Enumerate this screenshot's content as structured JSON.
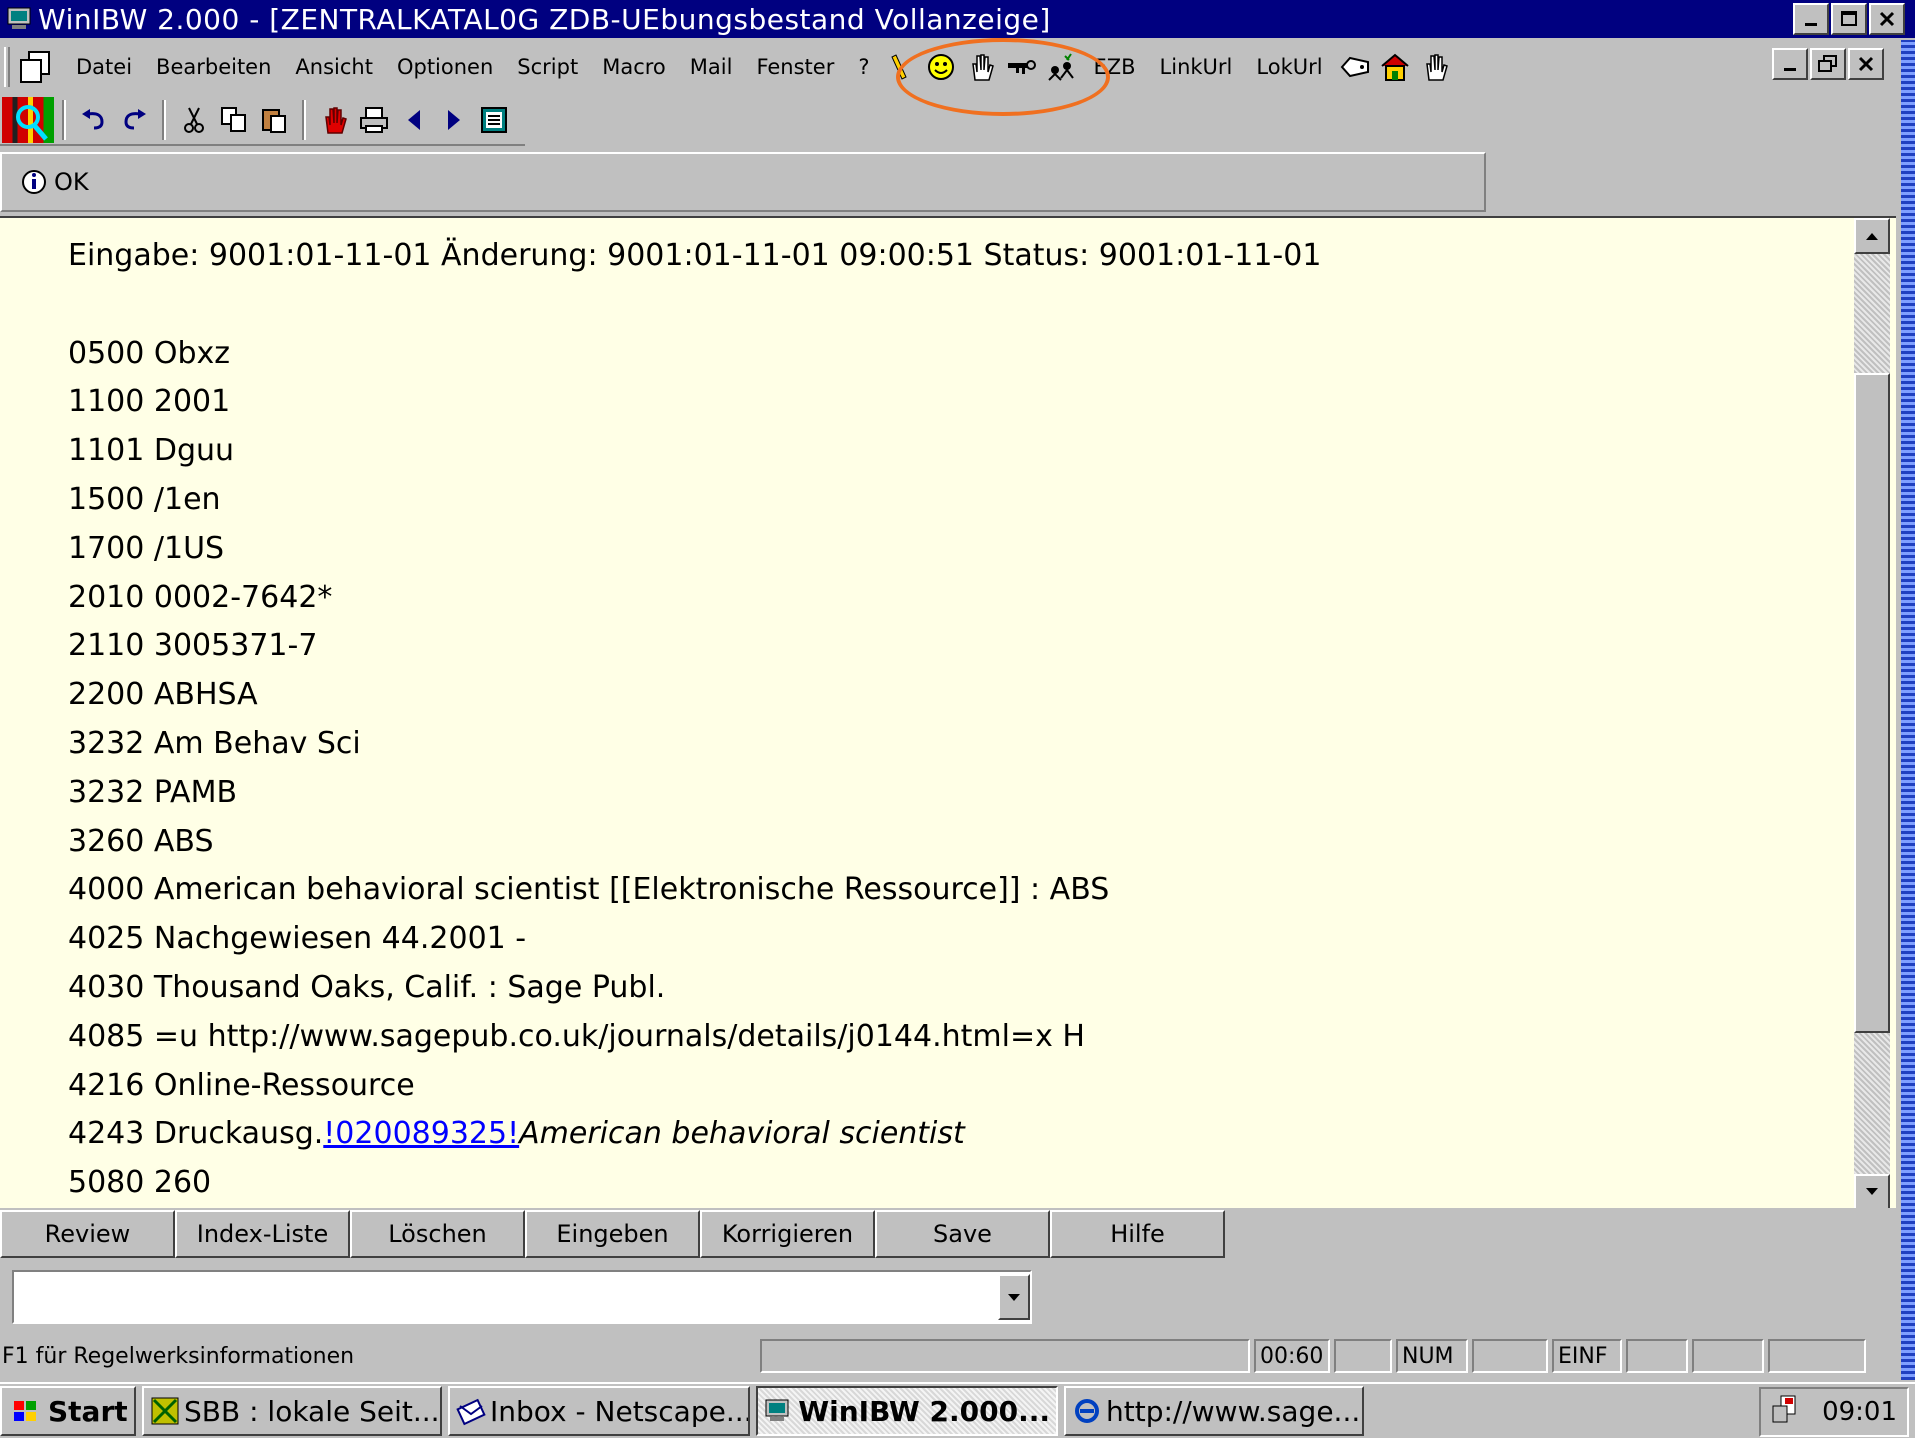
{
  "window": {
    "title": "WinIBW 2.000 - [ZENTRALKATAL0G ZDB-UEbungsbestand Vollanzeige]"
  },
  "menu": {
    "items": [
      "Datei",
      "Bearbeiten",
      "Ansicht",
      "Optionen",
      "Script",
      "Macro",
      "Mail",
      "Fenster",
      "?"
    ],
    "tool_links": [
      "EZB",
      "LinkUrl",
      "LokUrl"
    ]
  },
  "message": {
    "text": "OK"
  },
  "record": {
    "header": "Eingabe: 9001:01-11-01 Änderung: 9001:01-11-01 09:00:51 Status: 9001:01-11-01",
    "lines": [
      "0500 Obxz",
      "1100 2001",
      "1101 Dguu",
      "1500 /1en",
      "1700 /1US",
      "2010 0002-7642*",
      "2110 3005371-7",
      "2200 ABHSA",
      "3232 Am Behav Sci",
      "3232 PAMB",
      "3260 ABS",
      "4000 American behavioral scientist [[Elektronische Ressource]] : ABS",
      "4025 Nachgewiesen 44.2001 -",
      "4030 Thousand Oaks, Calif. : Sage Publ.",
      "4085 =u http://www.sagepub.co.uk/journals/details/j0144.html=x H",
      "4216 Online-Ressource"
    ],
    "line_4243_prefix": "4243 Druckausg.",
    "line_4243_link": "!020089325!",
    "line_4243_italic": "American behavioral scientist",
    "line_last": "5080 260"
  },
  "function_buttons": [
    "Review",
    "Index-Liste",
    "Löschen",
    "Eingeben",
    "Korrigieren",
    "Save",
    "Hilfe"
  ],
  "command": {
    "value": ""
  },
  "status": {
    "hint": "F1 für Regelwerksinformationen",
    "time_counter": "00:60",
    "num": "NUM",
    "mode": "EINF"
  },
  "taskbar": {
    "start": "Start",
    "tasks": [
      "SBB : lokale Seit...",
      "Inbox - Netscape...",
      "WinIBW 2.000...",
      "http://www.sage..."
    ],
    "clock": "09:01"
  },
  "colors": {
    "titlebar": "#000080",
    "content_bg": "#ffffe6",
    "link": "#0000ff",
    "highlight": "#f07020"
  }
}
